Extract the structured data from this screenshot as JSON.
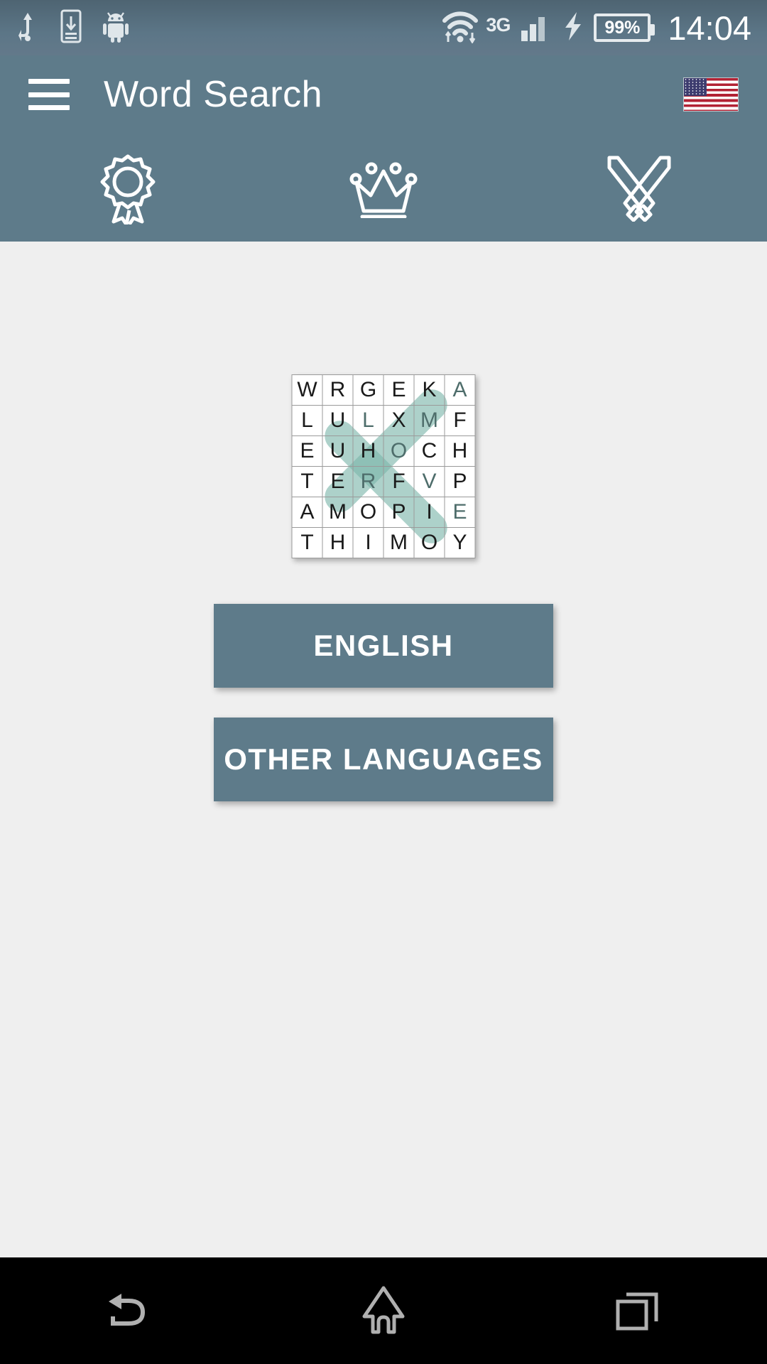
{
  "status_bar": {
    "left_icons": [
      "usb-icon",
      "screenshot-saved-icon",
      "android-robot-icon"
    ],
    "network_type": "3G",
    "battery_percent": "99%",
    "clock": "14:04",
    "right_icons": [
      "wifi-icon",
      "signal-bars-icon",
      "charging-bolt-icon",
      "battery-icon"
    ]
  },
  "app_bar": {
    "menu_icon": "hamburger-menu-icon",
    "title": "Word Search",
    "flag": "us-flag-icon",
    "icons": [
      {
        "name": "award-medal-icon"
      },
      {
        "name": "crown-icon"
      },
      {
        "name": "crossed-swords-icon"
      }
    ],
    "background_color": "#5e7b8a"
  },
  "board": {
    "rows": 6,
    "cols": 6,
    "letters": [
      [
        "W",
        "R",
        "G",
        "E",
        "K",
        "A"
      ],
      [
        "L",
        "U",
        "L",
        "X",
        "M",
        "F"
      ],
      [
        "E",
        "U",
        "H",
        "O",
        "C",
        "H"
      ],
      [
        "T",
        "E",
        "R",
        "F",
        "V",
        "P"
      ],
      [
        "A",
        "M",
        "O",
        "P",
        "I",
        "E"
      ],
      [
        "T",
        "H",
        "I",
        "M",
        "O",
        "Y"
      ]
    ],
    "highlight_color": "#7ab4aa",
    "highlighted_cells": [
      {
        "row": 0,
        "col": 5
      },
      {
        "row": 1,
        "col": 2
      },
      {
        "row": 1,
        "col": 4
      },
      {
        "row": 2,
        "col": 3
      },
      {
        "row": 3,
        "col": 2
      },
      {
        "row": 3,
        "col": 4
      },
      {
        "row": 4,
        "col": 5
      }
    ]
  },
  "buttons": {
    "english": "ENGLISH",
    "other_languages": "OTHER LANGUAGES",
    "color": "#5e7b8a"
  },
  "nav_bar": {
    "back": "back-icon",
    "home": "home-icon",
    "recents": "recents-icon"
  }
}
